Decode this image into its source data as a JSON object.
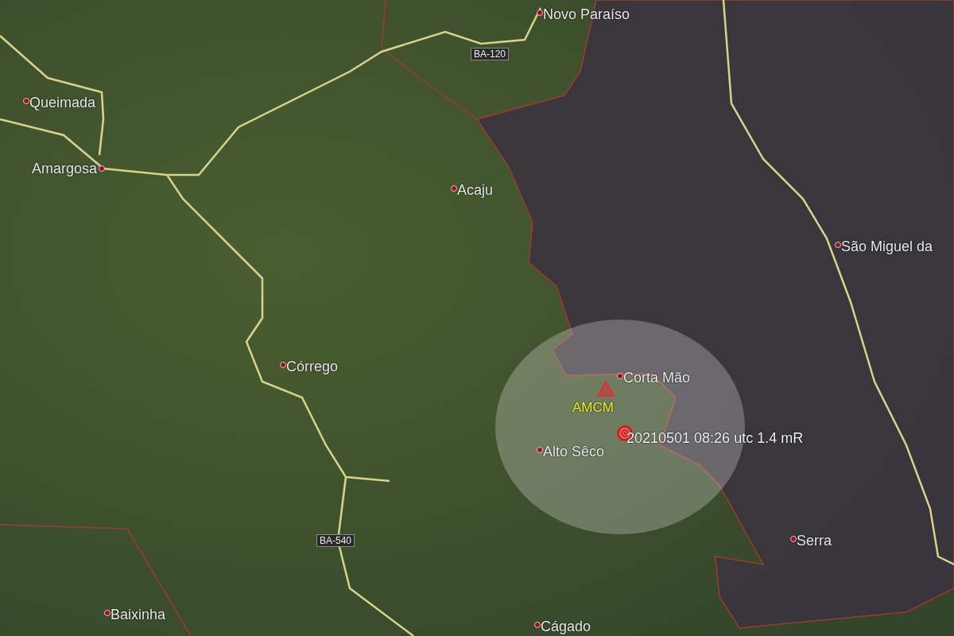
{
  "places": [
    {
      "name": "Novo Paraíso"
    },
    {
      "name": "Queimada"
    },
    {
      "name": "Amargosa"
    },
    {
      "name": "Acaju"
    },
    {
      "name": "São Miguel da"
    },
    {
      "name": "Córrego"
    },
    {
      "name": "Corta Mão"
    },
    {
      "name": "Alto Sêco"
    },
    {
      "name": "Serra"
    },
    {
      "name": "Baixinha"
    },
    {
      "name": "Cágado"
    }
  ],
  "roads": [
    {
      "label": "BA-120"
    },
    {
      "label": "BA-540"
    }
  ],
  "station": {
    "code": "AMCM"
  },
  "event": {
    "label": "20210501 08:26 utc 1.4 mR"
  }
}
